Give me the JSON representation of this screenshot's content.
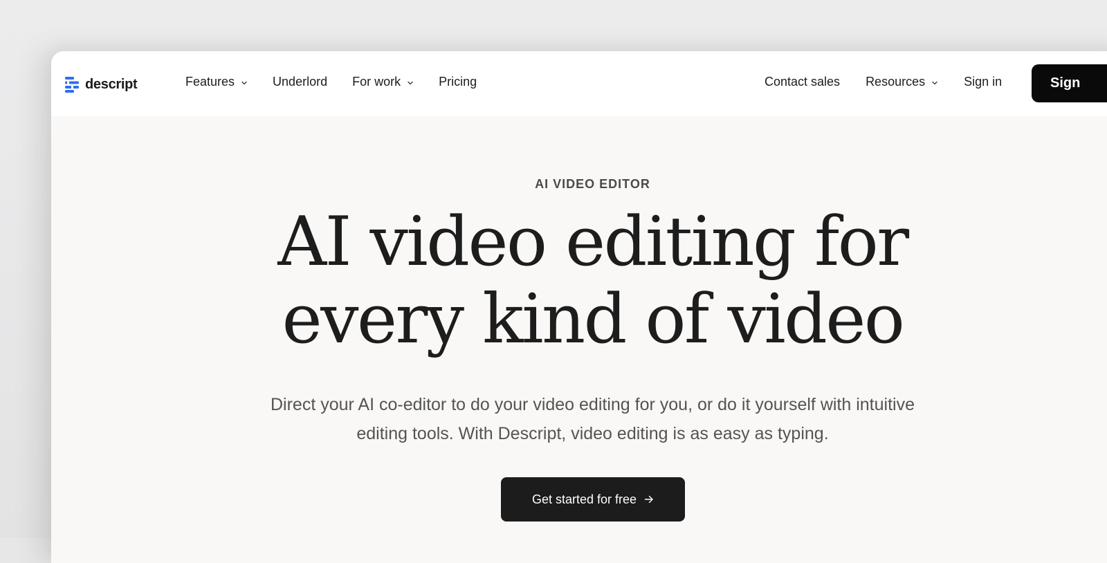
{
  "brand": {
    "name": "descript",
    "accent_color": "#2f6ff0"
  },
  "nav": {
    "left_items": [
      {
        "label": "Features",
        "has_dropdown": true
      },
      {
        "label": "Underlord",
        "has_dropdown": false
      },
      {
        "label": "For work",
        "has_dropdown": true
      },
      {
        "label": "Pricing",
        "has_dropdown": false
      }
    ],
    "right_items": [
      {
        "label": "Contact sales",
        "has_dropdown": false
      },
      {
        "label": "Resources",
        "has_dropdown": true
      },
      {
        "label": "Sign in",
        "has_dropdown": false
      }
    ],
    "signup_label": "Sign"
  },
  "hero": {
    "eyebrow": "AI VIDEO EDITOR",
    "headline_line1": "AI video editing for",
    "headline_line2": "every kind of video",
    "subtext_line1": "Direct your AI co-editor to do your video editing for you, or do it yourself with intuitive",
    "subtext_line2": "editing tools. With Descript, video editing is as easy as typing.",
    "cta_label": "Get started for free",
    "cta_icon": "arrow-right-icon"
  },
  "icons": {
    "logo": "descript-logo-icon",
    "dropdown": "chevron-down-icon"
  }
}
